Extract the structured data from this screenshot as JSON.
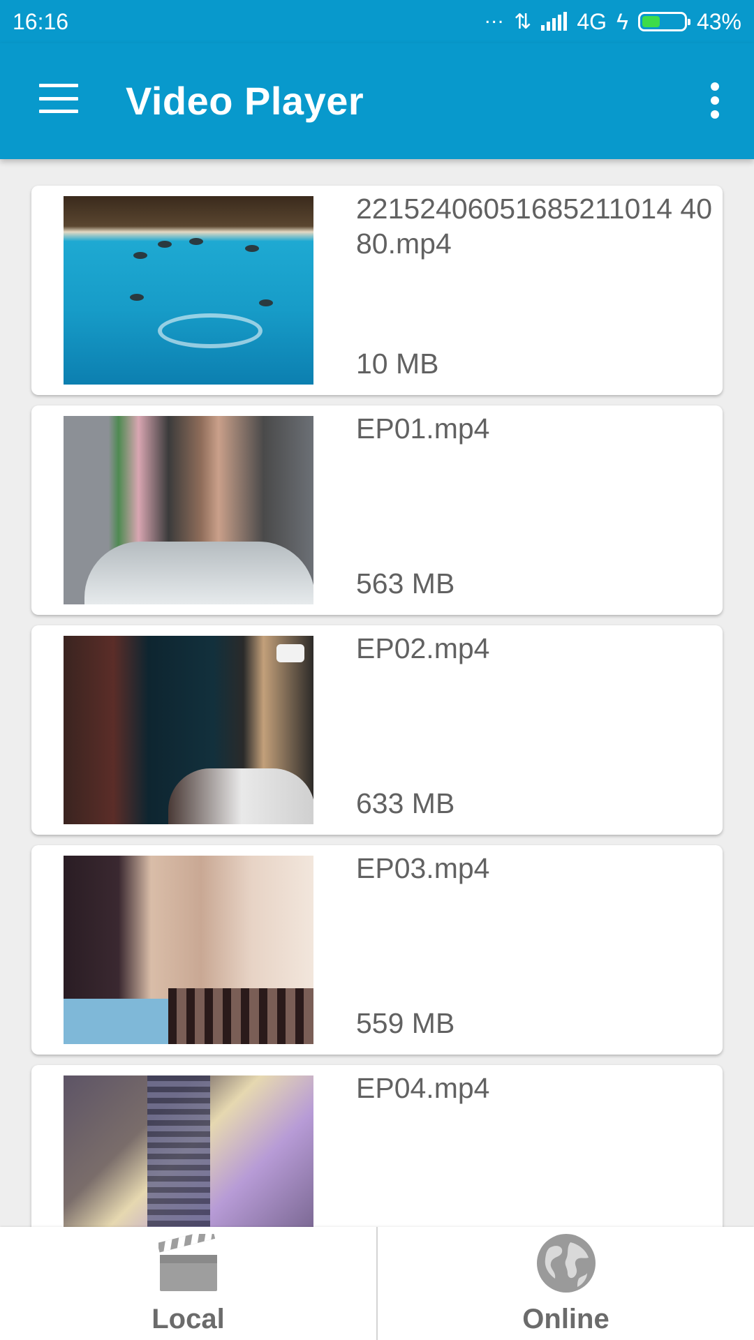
{
  "status_bar": {
    "time": "16:16",
    "dots": "...",
    "network": "4G",
    "battery_percent": "43%",
    "battery_level": 0.43
  },
  "app_bar": {
    "title": "Video Player",
    "menu_icon": "hamburger-menu-icon",
    "overflow_icon": "more-vert-icon"
  },
  "videos": [
    {
      "name": "22152406051685211014 4080.mp4",
      "size": "10 MB"
    },
    {
      "name": "EP01.mp4",
      "size": "563 MB"
    },
    {
      "name": "EP02.mp4",
      "size": "633 MB"
    },
    {
      "name": "EP03.mp4",
      "size": "559 MB"
    },
    {
      "name": "EP04.mp4",
      "size": ""
    }
  ],
  "bottom_nav": {
    "local_label": "Local",
    "online_label": "Online",
    "local_icon": "clapperboard-icon",
    "online_icon": "globe-icon"
  },
  "colors": {
    "primary": "#0899cc",
    "text_secondary": "#616161",
    "background": "#eeeeee"
  }
}
